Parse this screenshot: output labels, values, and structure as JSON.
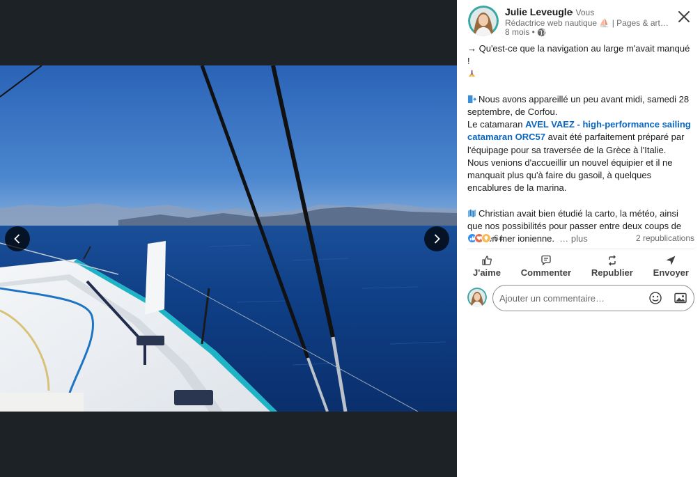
{
  "author": {
    "name": "Julie Leveugle",
    "degree": "• Vous",
    "headline": "Rédactrice web nautique ⛵ | Pages & articles de blog pour entreprises nautiques",
    "time": "8 mois •"
  },
  "post": {
    "line1": "→ Qu'est-ce que la navigation au large m'avait manqué !",
    "p1_text": "Nous avons appareillé un peu avant midi, samedi 28 septembre, de Corfou.",
    "p2_before": "Le catamaran ",
    "p2_link": "AVEL VAEZ - high-performance sailing catamaran ORC57",
    "p2_after": " avait été parfaitement préparé par l'équipage pour sa traversée de la Grèce à l'Italie.",
    "p3_text": "Nous venions d'accueillir un nouvel équipier et il ne manquait plus qu'à faire du gasoil, à quelques encablures de la marina.",
    "p4_text": "Christian avait bien étudié la carto, la météo, ainsi que nos possibilités pour passer entre deux coups de vent en mer ionienne.",
    "see_more": "… plus"
  },
  "social": {
    "reaction_count": "64",
    "reposts": "2 republications"
  },
  "actions": {
    "like": "J'aime",
    "comment": "Commenter",
    "repost": "Republier",
    "send": "Envoyer"
  },
  "comment_input": {
    "placeholder": "Ajouter un commentaire…"
  },
  "colors": {
    "link": "#0a66c2",
    "viewer_bg": "#1d2226",
    "sea": "#0d3f86",
    "sky": "#2f6dc0",
    "hull_accent": "#1fb3c6"
  },
  "icons": {
    "prev": "chevron-left-icon",
    "next": "chevron-right-icon",
    "close": "close-icon",
    "visibility": "globe-icon",
    "like": "thumbs-up-icon",
    "comment": "speech-bubble-icon",
    "repost": "repost-icon",
    "send": "send-icon",
    "emoji": "smiley-icon",
    "image": "image-icon"
  }
}
